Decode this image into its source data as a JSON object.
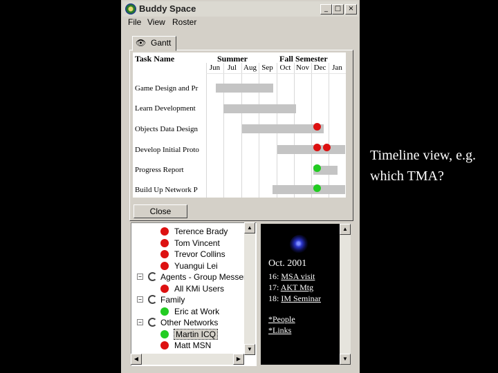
{
  "window": {
    "title": "Buddy Space"
  },
  "menu": {
    "file": "File",
    "view": "View",
    "roster": "Roster"
  },
  "tab": {
    "label": "Gantt"
  },
  "gantt": {
    "task_header": "Task Name",
    "seasons": [
      "Summer",
      "Fall Semester"
    ],
    "months": [
      "Jun",
      "Jul",
      "Aug",
      "Sep",
      "Oct",
      "Nov",
      "Dec",
      "Jan"
    ],
    "tasks": [
      "Game Design and Pr",
      "Learn Development",
      "Objects Data Design",
      "Develop Initial Proto",
      "Progress Report",
      "Build Up Network P"
    ]
  },
  "close_label": "Close",
  "roster": [
    {
      "label": "Terence Brady",
      "type": "contact",
      "status": "red"
    },
    {
      "label": "Tom Vincent",
      "type": "contact",
      "status": "red"
    },
    {
      "label": "Trevor Collins",
      "type": "contact",
      "status": "red"
    },
    {
      "label": "Yuangui Lei",
      "type": "contact",
      "status": "red"
    },
    {
      "label": "Agents - Group Messeng",
      "type": "group"
    },
    {
      "label": "All KMi Users",
      "type": "contact",
      "status": "red"
    },
    {
      "label": "Family",
      "type": "group"
    },
    {
      "label": "Eric at Work",
      "type": "contact",
      "status": "green"
    },
    {
      "label": "Other Networks",
      "type": "group"
    },
    {
      "label": "Martin ICQ",
      "type": "contact",
      "status": "green",
      "selected": true
    },
    {
      "label": "Matt MSN",
      "type": "contact",
      "status": "red"
    }
  ],
  "info": {
    "month": "Oct. 2001",
    "events": [
      {
        "day": "16:",
        "name": "MSA visit"
      },
      {
        "day": "17:",
        "name": "AKT Mtg"
      },
      {
        "day": "18:",
        "name": "IM Seminar"
      }
    ],
    "links": [
      "*People",
      "*Links"
    ]
  },
  "caption": {
    "line1": "Timeline view, e.g.",
    "line2": "which TMA?"
  },
  "colors": {
    "red": "#dd1111",
    "green": "#22cc22",
    "bar": "#c4c4c4"
  }
}
